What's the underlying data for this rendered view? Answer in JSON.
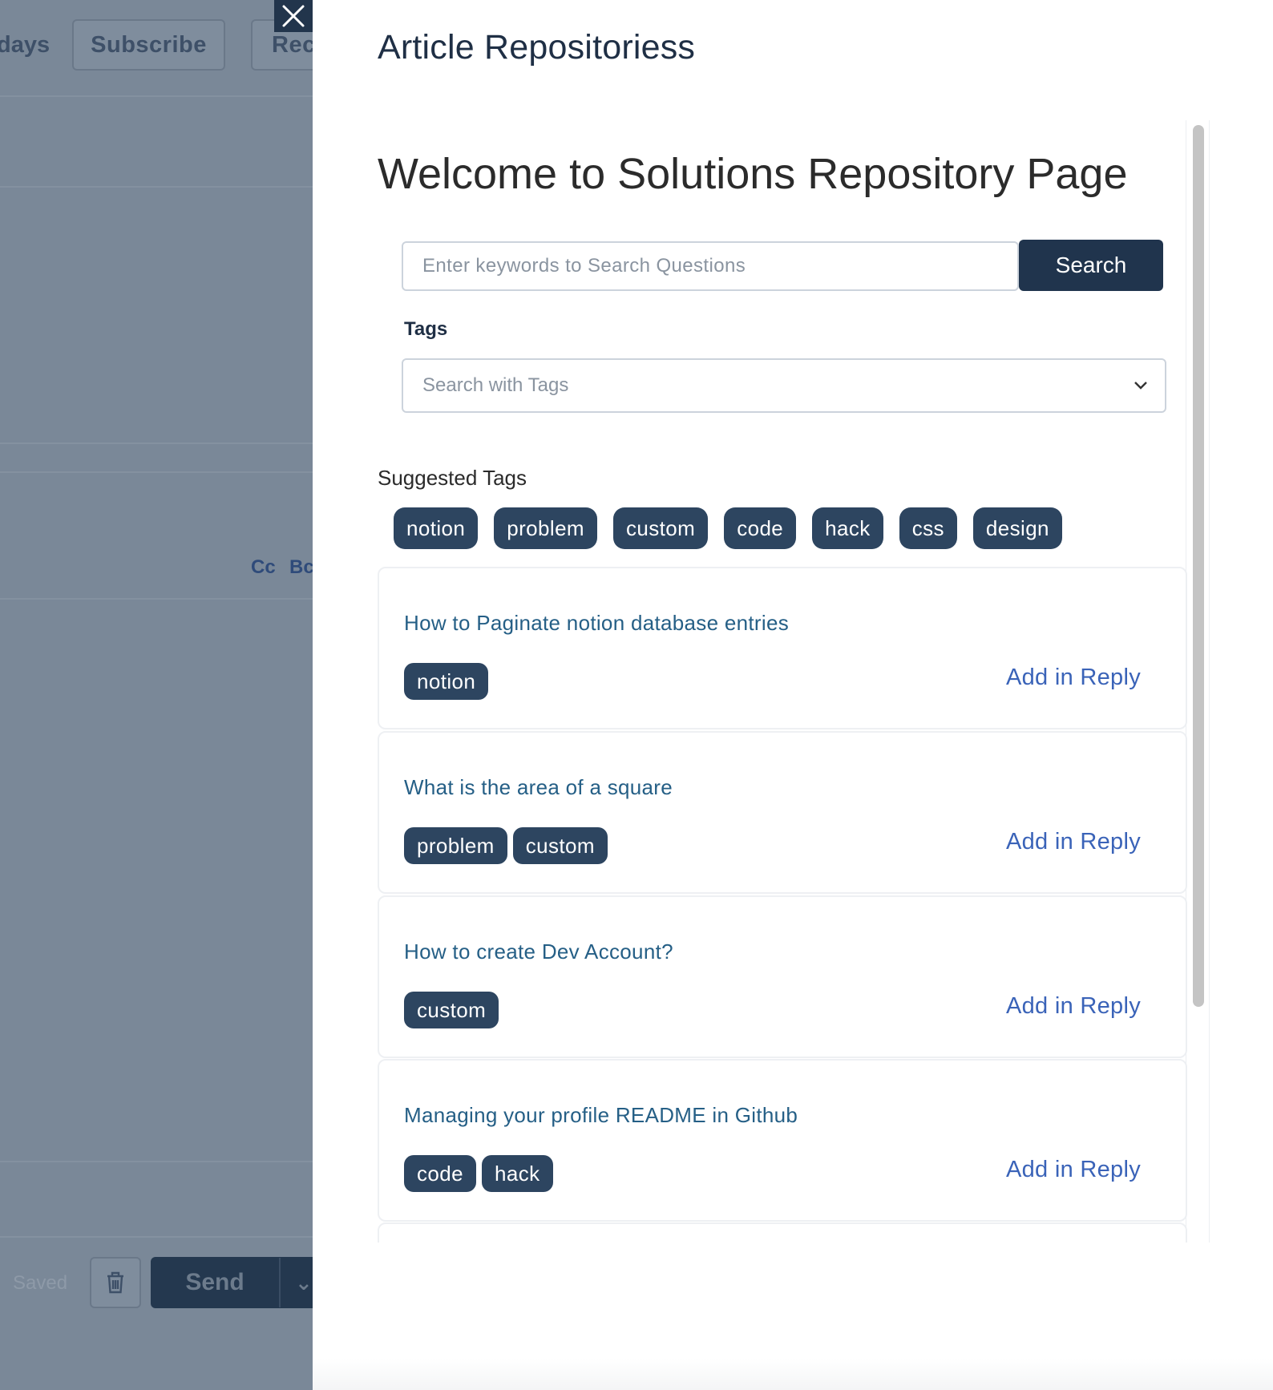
{
  "background": {
    "partial_text_days": "days",
    "subscribe_label": "Subscribe",
    "partial_button_rec": "Rec",
    "cc_label": "Cc",
    "bcc_partial": "Bc",
    "saved_label": "Saved",
    "send_label": "Send"
  },
  "drawer": {
    "title": "Article Repositoriess",
    "welcome": "Welcome to Solutions Repository Page",
    "search": {
      "placeholder": "Enter keywords to Search Questions",
      "button_label": "Search"
    },
    "tags": {
      "label": "Tags",
      "placeholder": "Search with Tags"
    },
    "suggested": {
      "label": "Suggested Tags",
      "tags": [
        "notion",
        "problem",
        "custom",
        "code",
        "hack",
        "css",
        "design"
      ]
    },
    "articles": [
      {
        "question": "How to Paginate notion database entries",
        "tags": [
          "notion"
        ],
        "action": "Add in Reply"
      },
      {
        "question": "What is the area of a square",
        "tags": [
          "problem",
          "custom"
        ],
        "action": "Add in Reply"
      },
      {
        "question": "How to create Dev Account?",
        "tags": [
          "custom"
        ],
        "action": "Add in Reply"
      },
      {
        "question": "Managing your profile README in Github",
        "tags": [
          "code",
          "hack"
        ],
        "action": "Add in Reply"
      }
    ]
  },
  "colors": {
    "primary_dark": "#20344d",
    "pill": "#2d4560",
    "link": "#3a63b8",
    "question": "#255f86",
    "overlay": "#7a8898"
  }
}
